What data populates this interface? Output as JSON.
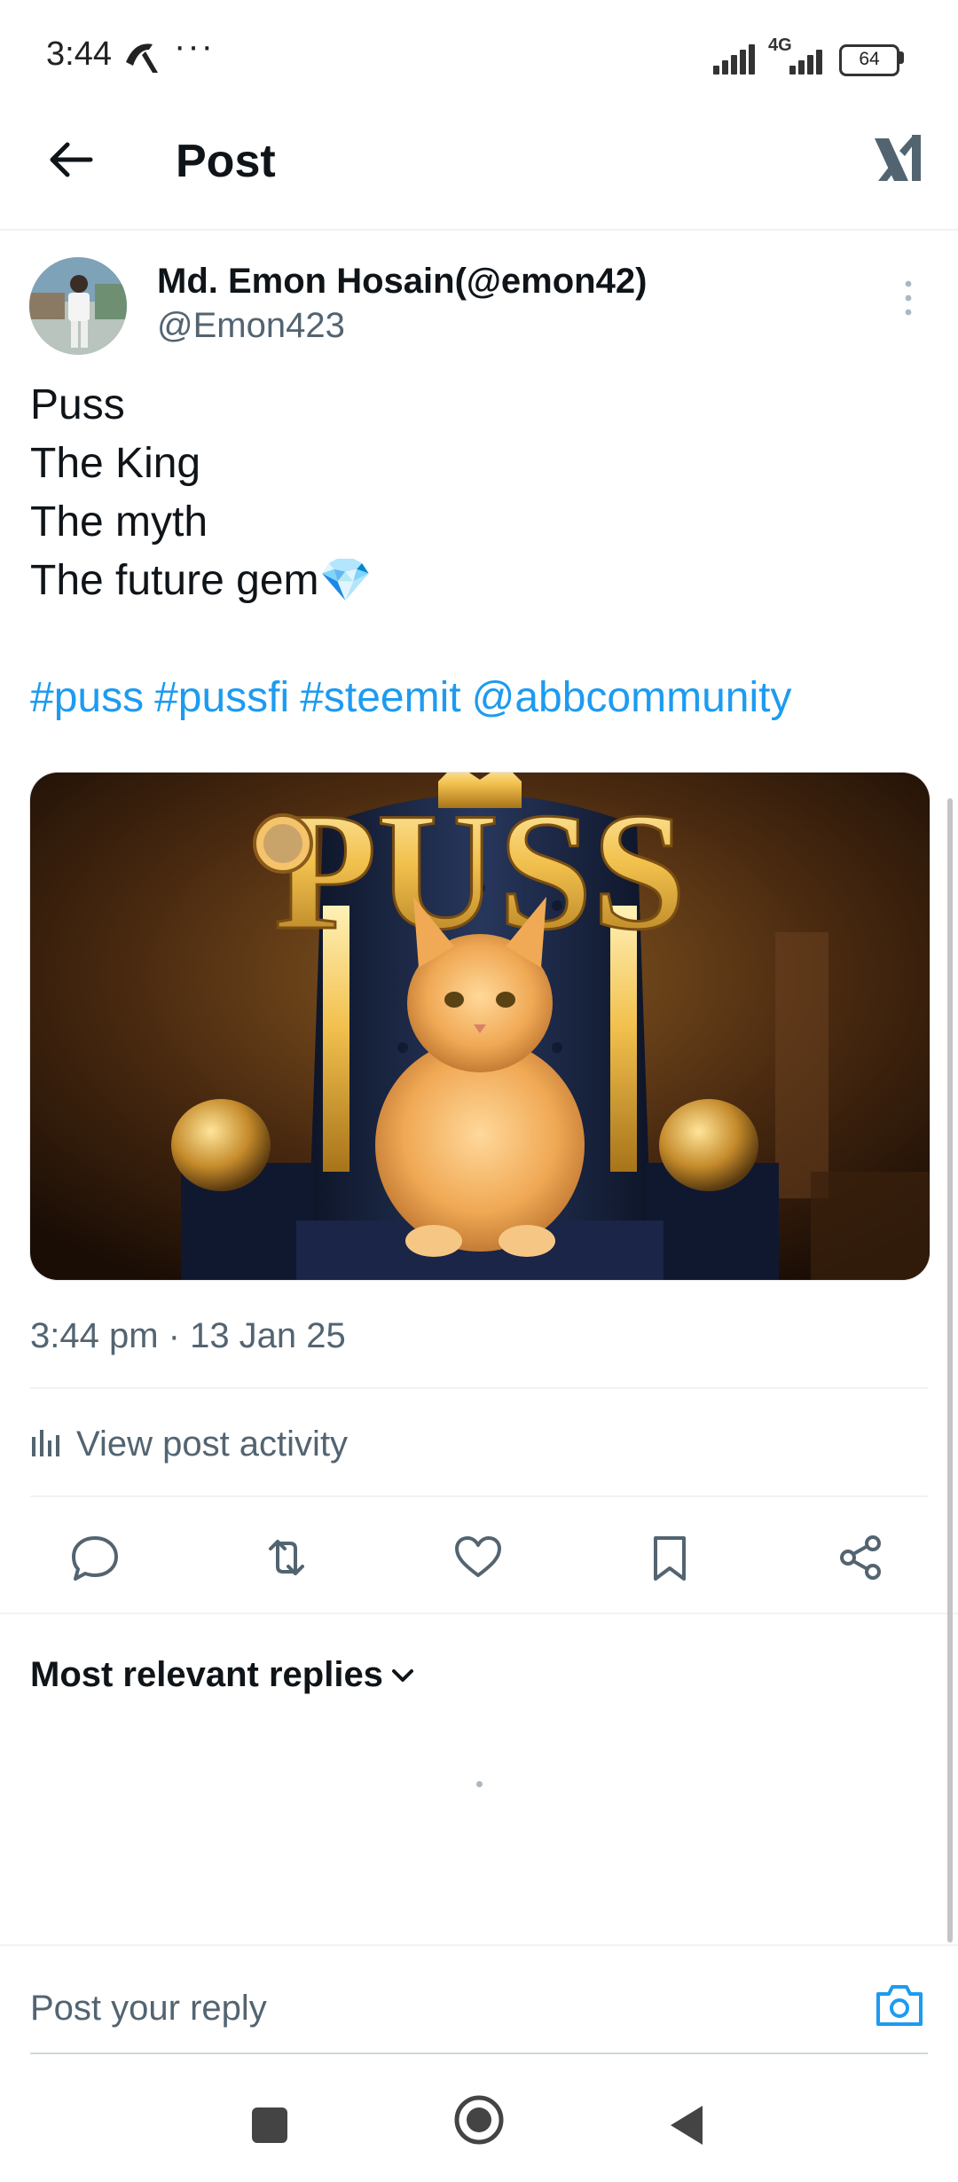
{
  "status_bar": {
    "time": "3:44",
    "network_label": "4G",
    "battery": "64",
    "overflow_indicator": "···"
  },
  "header": {
    "title": "Post",
    "back_icon": "arrow-left-icon",
    "logo_icon": "x-logo-icon"
  },
  "post": {
    "author": {
      "name": "Md. Emon Hosain(@emon42)",
      "handle": "@Emon423"
    },
    "text": "Puss\nThe King\nThe myth\nThe future gem💎",
    "tags": [
      "#puss",
      "#pussfi",
      "#steemit",
      "@abbcommunity"
    ],
    "media_text": "PUSS",
    "timestamp": "3:44 pm · 13 Jan 25",
    "activity_label": "View post activity",
    "actions": [
      "reply-icon",
      "repost-icon",
      "like-icon",
      "bookmark-icon",
      "share-icon"
    ]
  },
  "replies": {
    "sort_label": "Most relevant replies"
  },
  "reply_box": {
    "placeholder": "Post your reply"
  },
  "colors": {
    "accent": "#1d9bf0",
    "text_primary": "#0f1419",
    "text_secondary": "#536471",
    "divider": "#eff3f4"
  }
}
